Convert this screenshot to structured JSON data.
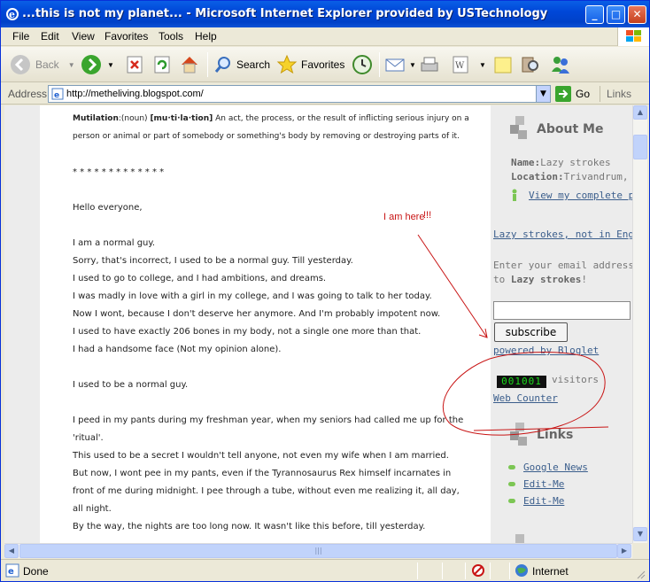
{
  "window": {
    "title": "...this is not my planet... - Microsoft Internet Explorer provided by USTechnology",
    "minimize": "_",
    "maximize": "□",
    "close": "✕"
  },
  "menu": [
    "File",
    "Edit",
    "View",
    "Favorites",
    "Tools",
    "Help"
  ],
  "toolbar": {
    "back": "Back",
    "search": "Search",
    "favorites": "Favorites"
  },
  "address": {
    "label": "Address",
    "url": "http://metheliving.blogspot.com/",
    "go": "Go",
    "links": "Links"
  },
  "post": {
    "def_term": "Mutilation",
    "def_pos": ":(noun) ",
    "def_pron": "[mu·ti·la·tion]",
    "def_text1": " An act, the process, or the result of inflicting serious injury on a",
    "def_text2": "person or animal or part of somebody or something's body by removing or destroying parts of it.",
    "lines": [
      "* * * * * * * * * * * * *",
      "Hello everyone,",
      "I am a normal guy.",
      "Sorry, that's incorrect, I used to be a normal guy. Till yesterday.",
      "I used to go to college, and I had ambitions, and dreams.",
      "I was madly in love with a girl in my college, and I was going to talk to her today.",
      "Now I wont, because I don't deserve her anymore. And I'm probably impotent now.",
      "I used to have exactly 206 bones in my body, not a single one more than that.",
      "I had a handsome face (Not my opinion alone).",
      "I used to be a normal guy.",
      "I peed in my pants during my freshman year, when my seniors had called me up for the",
      "'ritual'.",
      "This used to be a secret I wouldn't tell anyone, not even my wife when I am married.",
      "But now, I wont pee in my pants, even if the Tyrannosaurus Rex himself incarnates in",
      "front of me during midnight. I pee through a tube, without even me realizing it, all day,",
      "all night.",
      "By the way, the nights are too long now. It wasn't like this before, till yesterday."
    ]
  },
  "annotation": {
    "text": "I am here",
    "marks": "!!!"
  },
  "sidebar": {
    "about_title": "About Me",
    "name_label": "Name:",
    "name_value": "Lazy strokes",
    "location_label": "Location:",
    "location_value": "Trivandrum, I",
    "profile_link": "View my complete pr",
    "blog_link": "Lazy strokes, not in English",
    "email_text1": "Enter your email address b",
    "email_text2_pre": "to ",
    "email_text2_bold": "Lazy strokes",
    "email_text2_post": "!",
    "subscribe": "subscribe",
    "powered": "powered by Bloglet",
    "counter": "001001",
    "visitors": "visitors",
    "web_counter": "Web Counter",
    "links_title": "Links",
    "links": [
      "Google News",
      "Edit-Me",
      "Edit-Me"
    ]
  },
  "status": {
    "done": "Done",
    "zone": "Internet"
  }
}
